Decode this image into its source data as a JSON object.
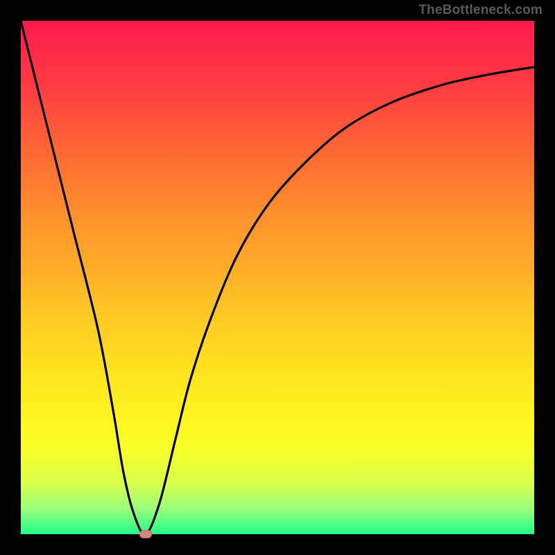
{
  "watermark": "TheBottleneck.com",
  "chart_data": {
    "type": "line",
    "title": "",
    "xlabel": "",
    "ylabel": "",
    "xlim": [
      0,
      100
    ],
    "ylim": [
      0,
      100
    ],
    "grid": false,
    "series": [
      {
        "name": "curve",
        "x": [
          0,
          5,
          10,
          15,
          18,
          20,
          22,
          24.3,
          27,
          30,
          33,
          37,
          42,
          48,
          55,
          63,
          72,
          82,
          91,
          100
        ],
        "y": [
          100,
          80,
          60,
          40,
          24,
          12,
          4,
          0,
          6,
          18,
          30,
          42,
          54,
          64,
          72,
          79,
          84,
          87.5,
          89.5,
          91
        ]
      }
    ],
    "marker": {
      "x": 24.3,
      "y": 0
    },
    "background_gradient": {
      "top": "#ff1a4d",
      "mid": "#ffe61f",
      "bottom": "#22ff88"
    }
  }
}
